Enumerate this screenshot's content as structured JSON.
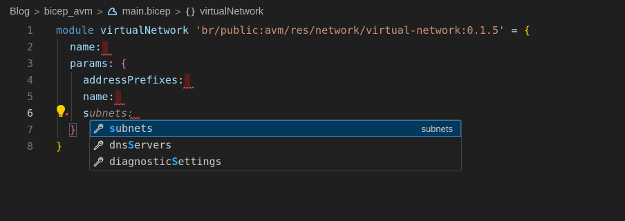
{
  "breadcrumb": {
    "items": [
      "Blog",
      "bicep_avm",
      "main.bicep",
      "virtualNetwork"
    ],
    "separator": ">",
    "file_icon": "bicep-file-icon",
    "symbol_icon": "{}"
  },
  "editor": {
    "line_numbers": [
      "1",
      "2",
      "3",
      "4",
      "5",
      "6",
      "7",
      "8"
    ],
    "active_line": "6",
    "lines": {
      "l1": {
        "kw": "module",
        "name": "virtualNetwork",
        "str": "'br/public:avm/res/network/virtual-network:0.1.5'",
        "eq": "=",
        "brace": "{"
      },
      "l2": {
        "prop": "name",
        "colon": ":"
      },
      "l3": {
        "prop": "params",
        "colon": ":",
        "brace": "{"
      },
      "l4": {
        "prop": "addressPrefixes",
        "colon": ":"
      },
      "l5": {
        "prop": "name",
        "colon": ":"
      },
      "l6": {
        "typed": "s",
        "ghost": "ubnets:"
      },
      "l7": {
        "brace": "}"
      },
      "l8": {
        "brace": "}"
      }
    }
  },
  "suggestions": {
    "items": [
      {
        "pre": "",
        "match": "s",
        "post": "ubnets",
        "detail": "subnets",
        "icon": "wrench-icon"
      },
      {
        "pre": "dns",
        "match": "S",
        "post": "ervers",
        "detail": "",
        "icon": "wrench-icon"
      },
      {
        "pre": "diagnostic",
        "match": "S",
        "post": "ettings",
        "detail": "",
        "icon": "wrench-icon"
      }
    ]
  },
  "colors": {
    "background": "#1f1f1f",
    "keyword": "#569cd6",
    "identifier": "#9cdcfe",
    "string": "#ce9178",
    "brace_level1": "#ffd700",
    "brace_level2": "#da70d6",
    "selection": "#04395e",
    "match_highlight": "#2aaaff",
    "error_squiggle": "#f14c4c",
    "lightbulb": "#ffcc00"
  }
}
